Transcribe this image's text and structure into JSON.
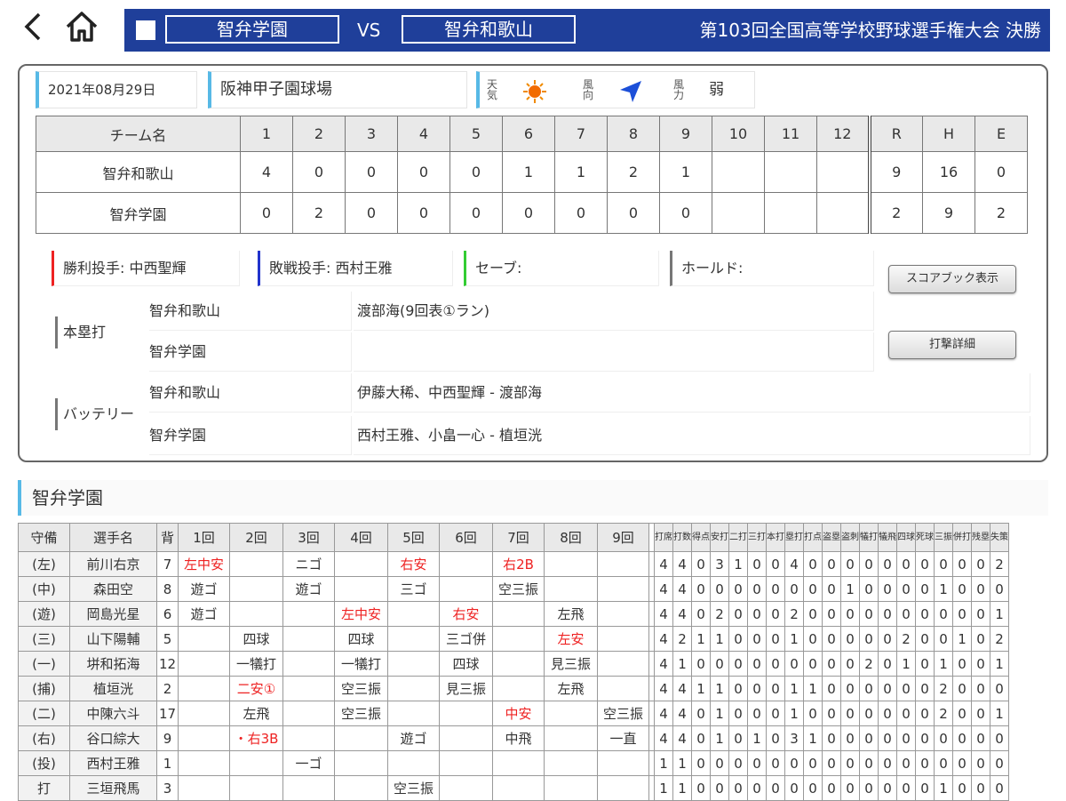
{
  "header": {
    "home_team": "智弁学園",
    "vs": "VS",
    "away_team": "智弁和歌山",
    "tournament": "第103回全国高等学校野球選手権大会 決勝"
  },
  "info": {
    "date": "2021年08月29日",
    "stadium": "阪神甲子園球場",
    "weather_label": "天気",
    "weather_icon": "sun-icon",
    "wind_dir_label": "風向",
    "wind_dir_icon": "arrow-icon",
    "wind_power_label": "風力",
    "wind_power": "弱"
  },
  "scoreboard": {
    "headers": [
      "チーム名",
      "1",
      "2",
      "3",
      "4",
      "5",
      "6",
      "7",
      "8",
      "9",
      "10",
      "11",
      "12",
      "R",
      "H",
      "E"
    ],
    "rows": [
      {
        "team": "智弁和歌山",
        "innings": [
          "4",
          "0",
          "0",
          "0",
          "0",
          "1",
          "1",
          "2",
          "1",
          "",
          "",
          ""
        ],
        "r": "9",
        "h": "16",
        "e": "0"
      },
      {
        "team": "智弁学園",
        "innings": [
          "0",
          "2",
          "0",
          "0",
          "0",
          "0",
          "0",
          "0",
          "0",
          "",
          "",
          ""
        ],
        "r": "2",
        "h": "9",
        "e": "2"
      }
    ]
  },
  "results": {
    "win": "勝利投手: 中西聖輝",
    "lose": "敗戦投手: 西村王雅",
    "save": "セーブ:",
    "hold": "ホールド:"
  },
  "colors": {
    "win": "#e22",
    "lose": "#2233cc",
    "save": "#33cc33",
    "hold": "#777",
    "accent": "#57b9e6",
    "header": "#1f3f9a"
  },
  "buttons": {
    "scorebook": "スコアブック表示",
    "batting": "打撃詳細"
  },
  "homeruns": {
    "label": "本塁打",
    "team1": "智弁和歌山",
    "team1_value": "渡部海(9回表①ラン)",
    "team2": "智弁学園",
    "team2_value": ""
  },
  "battery": {
    "label": "バッテリー",
    "team1": "智弁和歌山",
    "team1_value": "伊藤大稀、中西聖輝 - 渡部海",
    "team2": "智弁学園",
    "team2_value": "西村王雅、小畠一心 - 植垣洸"
  },
  "section_title": "智弁学園",
  "batting": {
    "headers": [
      "守備",
      "選手名",
      "背",
      "1回",
      "2回",
      "3回",
      "4回",
      "5回",
      "6回",
      "7回",
      "8回",
      "9回"
    ],
    "stat_headers": [
      "打席",
      "打数",
      "得点",
      "安打",
      "二打",
      "三打",
      "本打",
      "塁打",
      "打点",
      "盗塁",
      "盗刺",
      "犠打",
      "犠飛",
      "四球",
      "死球",
      "三振",
      "併打",
      "残塁",
      "失策"
    ],
    "players": [
      {
        "pos": "(左)",
        "name": "前川右京",
        "num": "7",
        "inn": [
          "左中安",
          "",
          "ニゴ",
          "",
          "右安",
          "",
          "右2B",
          "",
          ""
        ],
        "hit": [
          1,
          0,
          0,
          0,
          1,
          0,
          1,
          0,
          0
        ],
        "stats": [
          "4",
          "4",
          "0",
          "3",
          "1",
          "0",
          "0",
          "4",
          "0",
          "0",
          "0",
          "0",
          "0",
          "0",
          "0",
          "0",
          "0",
          "0",
          "2"
        ]
      },
      {
        "pos": "(中)",
        "name": "森田空",
        "num": "8",
        "inn": [
          "遊ゴ",
          "",
          "遊ゴ",
          "",
          "三ゴ",
          "",
          "空三振",
          "",
          ""
        ],
        "hit": [
          0,
          0,
          0,
          0,
          0,
          0,
          0,
          0,
          0
        ],
        "stats": [
          "4",
          "4",
          "0",
          "0",
          "0",
          "0",
          "0",
          "0",
          "0",
          "0",
          "1",
          "0",
          "0",
          "0",
          "0",
          "1",
          "0",
          "0",
          "0"
        ]
      },
      {
        "pos": "(遊)",
        "name": "岡島光星",
        "num": "6",
        "inn": [
          "遊ゴ",
          "",
          "",
          "左中安",
          "",
          "右安",
          "",
          "左飛",
          ""
        ],
        "hit": [
          0,
          0,
          0,
          1,
          0,
          1,
          0,
          0,
          0
        ],
        "stats": [
          "4",
          "4",
          "0",
          "2",
          "0",
          "0",
          "0",
          "2",
          "0",
          "0",
          "0",
          "0",
          "0",
          "0",
          "0",
          "0",
          "0",
          "0",
          "1"
        ]
      },
      {
        "pos": "(三)",
        "name": "山下陽輔",
        "num": "5",
        "inn": [
          "",
          "四球",
          "",
          "四球",
          "",
          "三ゴ併",
          "",
          "左安",
          ""
        ],
        "hit": [
          0,
          0,
          0,
          0,
          0,
          0,
          0,
          1,
          0
        ],
        "stats": [
          "4",
          "2",
          "1",
          "1",
          "0",
          "0",
          "0",
          "1",
          "0",
          "0",
          "0",
          "0",
          "0",
          "2",
          "0",
          "0",
          "1",
          "0",
          "2"
        ]
      },
      {
        "pos": "(一)",
        "name": "垪和拓海",
        "num": "12",
        "inn": [
          "",
          "一犠打",
          "",
          "一犠打",
          "",
          "四球",
          "",
          "見三振",
          ""
        ],
        "hit": [
          0,
          0,
          0,
          0,
          0,
          0,
          0,
          0,
          0
        ],
        "stats": [
          "4",
          "1",
          "0",
          "0",
          "0",
          "0",
          "0",
          "0",
          "0",
          "0",
          "0",
          "2",
          "0",
          "1",
          "0",
          "1",
          "0",
          "0",
          "1"
        ]
      },
      {
        "pos": "(捕)",
        "name": "植垣洸",
        "num": "2",
        "inn": [
          "",
          "二安①",
          "",
          "空三振",
          "",
          "見三振",
          "",
          "左飛",
          ""
        ],
        "hit": [
          0,
          1,
          0,
          0,
          0,
          0,
          0,
          0,
          0
        ],
        "stats": [
          "4",
          "4",
          "1",
          "1",
          "0",
          "0",
          "0",
          "1",
          "1",
          "0",
          "0",
          "0",
          "0",
          "0",
          "0",
          "2",
          "0",
          "0",
          "0"
        ]
      },
      {
        "pos": "(二)",
        "name": "中陳六斗",
        "num": "17",
        "inn": [
          "",
          "左飛",
          "",
          "空三振",
          "",
          "",
          "中安",
          "",
          "空三振"
        ],
        "hit": [
          0,
          0,
          0,
          0,
          0,
          0,
          1,
          0,
          0
        ],
        "stats": [
          "4",
          "4",
          "0",
          "1",
          "0",
          "0",
          "0",
          "1",
          "0",
          "0",
          "0",
          "0",
          "0",
          "0",
          "0",
          "2",
          "0",
          "0",
          "1"
        ]
      },
      {
        "pos": "(右)",
        "name": "谷口綜大",
        "num": "9",
        "inn": [
          "",
          "・右3B",
          "",
          "",
          "遊ゴ",
          "",
          "中飛",
          "",
          "一直"
        ],
        "hit": [
          0,
          1,
          0,
          0,
          0,
          0,
          0,
          0,
          0
        ],
        "stats": [
          "4",
          "4",
          "0",
          "1",
          "0",
          "1",
          "0",
          "3",
          "1",
          "0",
          "0",
          "0",
          "0",
          "0",
          "0",
          "0",
          "0",
          "0",
          "0"
        ]
      },
      {
        "pos": "(投)",
        "name": "西村王雅",
        "num": "1",
        "inn": [
          "",
          "",
          "一ゴ",
          "",
          "",
          "",
          "",
          "",
          ""
        ],
        "hit": [
          0,
          0,
          0,
          0,
          0,
          0,
          0,
          0,
          0
        ],
        "stats": [
          "1",
          "1",
          "0",
          "0",
          "0",
          "0",
          "0",
          "0",
          "0",
          "0",
          "0",
          "0",
          "0",
          "0",
          "0",
          "0",
          "0",
          "0",
          "0"
        ]
      },
      {
        "pos": "打",
        "name": "三垣飛馬",
        "num": "3",
        "inn": [
          "",
          "",
          "",
          "",
          "空三振",
          "",
          "",
          "",
          ""
        ],
        "hit": [
          0,
          0,
          0,
          0,
          0,
          0,
          0,
          0,
          0
        ],
        "stats": [
          "1",
          "1",
          "0",
          "0",
          "0",
          "0",
          "0",
          "0",
          "0",
          "0",
          "0",
          "0",
          "0",
          "0",
          "0",
          "1",
          "0",
          "0",
          "0"
        ]
      }
    ]
  }
}
